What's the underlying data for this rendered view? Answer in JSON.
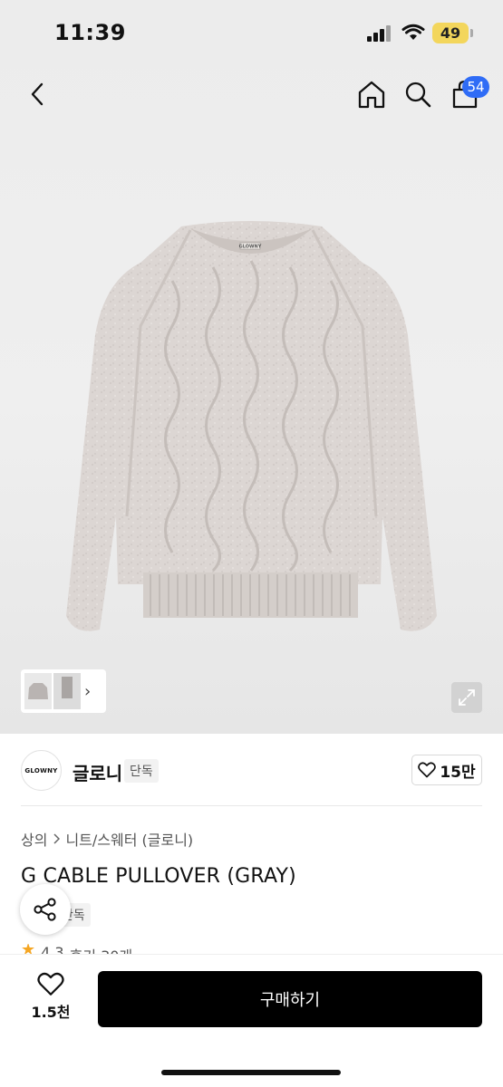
{
  "status_bar": {
    "time": "11:39",
    "battery": "49"
  },
  "nav": {
    "cart_count": "54"
  },
  "product_image": {
    "brand_mark": "GLOWNY"
  },
  "brand": {
    "logo_text": "GLOWNY",
    "name": "글로니",
    "tag": "단독",
    "likes": "15만"
  },
  "breadcrumb": {
    "level1": "상의",
    "level2": "니트/스웨터 (글로니)"
  },
  "product": {
    "title": "G CABLE PULLOVER (GRAY)",
    "exclusive_tag": "단독",
    "rating": "4.3",
    "review_label": "후기 30개"
  },
  "bottom": {
    "like_count": "1.5천",
    "buy_label": "구매하기"
  },
  "colors": {
    "accent_badge": "#2f6cf6",
    "buy_button": "#000000",
    "star": "#f5a623"
  }
}
